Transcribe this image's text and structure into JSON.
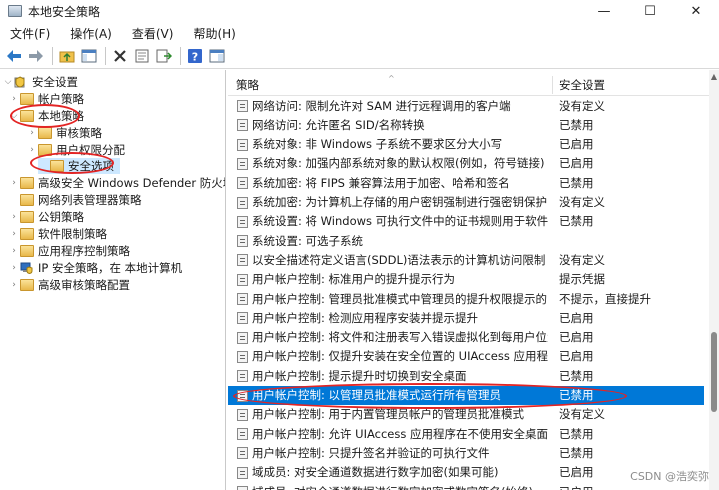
{
  "window": {
    "title": "本地安全策略",
    "minimize_glyph": "—",
    "maximize_glyph": "☐",
    "close_glyph": "✕"
  },
  "menu": [
    "文件(F)",
    "操作(A)",
    "查看(V)",
    "帮助(H)"
  ],
  "toolbar_icons": [
    "back-arrow-icon",
    "forward-arrow-icon",
    "up-folder-icon",
    "show-hide-tree-icon",
    "delete-icon",
    "properties-icon",
    "export-icon",
    "help-icon",
    "console-icon"
  ],
  "tree": [
    {
      "label": "安全设置",
      "arrow": "⌵",
      "icon": "shield-icon"
    },
    {
      "label": "帐户策略",
      "arrow": "›",
      "icon": "folder-icon"
    },
    {
      "label": "本地策略",
      "arrow": "⌵",
      "icon": "folder-open-icon"
    },
    {
      "label": "审核策略",
      "arrow": "›",
      "icon": "folder-icon"
    },
    {
      "label": "用户权限分配",
      "arrow": "›",
      "icon": "folder-icon"
    },
    {
      "label": "安全选项",
      "arrow": "",
      "icon": "folder-icon"
    },
    {
      "label": "高级安全 Windows Defender 防火墙",
      "arrow": "›",
      "icon": "folder-icon"
    },
    {
      "label": "网络列表管理器策略",
      "arrow": "",
      "icon": "folder-icon"
    },
    {
      "label": "公钥策略",
      "arrow": "›",
      "icon": "folder-icon"
    },
    {
      "label": "软件限制策略",
      "arrow": "›",
      "icon": "folder-icon"
    },
    {
      "label": "应用程序控制策略",
      "arrow": "›",
      "icon": "folder-icon"
    },
    {
      "label": "IP 安全策略，在 本地计算机",
      "arrow": "›",
      "icon": "ipsec-icon"
    },
    {
      "label": "高级审核策略配置",
      "arrow": "›",
      "icon": "folder-icon"
    }
  ],
  "list": {
    "columns": {
      "policy": "策略",
      "setting": "安全设置"
    },
    "rows": [
      {
        "policy": "网络访问: 限制允许对 SAM 进行远程调用的客户端",
        "setting": "没有定义"
      },
      {
        "policy": "网络访问: 允许匿名 SID/名称转换",
        "setting": "已禁用"
      },
      {
        "policy": "系统对象: 非 Windows 子系统不要求区分大小写",
        "setting": "已启用"
      },
      {
        "policy": "系统对象: 加强内部系统对象的默认权限(例如，符号链接)",
        "setting": "已启用"
      },
      {
        "policy": "系统加密: 将 FIPS 兼容算法用于加密、哈希和签名",
        "setting": "已禁用"
      },
      {
        "policy": "系统加密: 为计算机上存储的用户密钥强制进行强密钥保护",
        "setting": "没有定义"
      },
      {
        "policy": "系统设置: 将 Windows 可执行文件中的证书规则用于软件限...",
        "setting": "已禁用"
      },
      {
        "policy": "系统设置: 可选子系统",
        "setting": ""
      },
      {
        "policy": "以安全描述符定义语言(SDDL)语法表示的计算机访问限制",
        "setting": "没有定义"
      },
      {
        "policy": "用户帐户控制: 标准用户的提升提示行为",
        "setting": "提示凭据"
      },
      {
        "policy": "用户帐户控制: 管理员批准模式中管理员的提升权限提示的...",
        "setting": "不提示，直接提升"
      },
      {
        "policy": "用户帐户控制: 检测应用程序安装并提示提升",
        "setting": "已启用"
      },
      {
        "policy": "用户帐户控制: 将文件和注册表写入错误虚拟化到每用户位置",
        "setting": "已启用"
      },
      {
        "policy": "用户帐户控制: 仅提升安装在安全位置的 UIAccess 应用程序",
        "setting": "已启用"
      },
      {
        "policy": "用户帐户控制: 提示提升时切换到安全桌面",
        "setting": "已禁用"
      },
      {
        "policy": "用户帐户控制: 以管理员批准模式运行所有管理员",
        "setting": "已禁用"
      },
      {
        "policy": "用户帐户控制: 用于内置管理员帐户的管理员批准模式",
        "setting": "没有定义"
      },
      {
        "policy": "用户帐户控制: 允许 UIAccess 应用程序在不使用安全桌面的...",
        "setting": "已禁用"
      },
      {
        "policy": "用户帐户控制: 只提升签名并验证的可执行文件",
        "setting": "已禁用"
      },
      {
        "policy": "域成员: 对安全通道数据进行数字加密(如果可能)",
        "setting": "已启用"
      },
      {
        "policy": "域成员: 对安全通道数据进行数字加密或数字签名(始终)",
        "setting": "已启用"
      }
    ],
    "selected_index": 15
  },
  "watermark": "CSDN @浩奕弥"
}
